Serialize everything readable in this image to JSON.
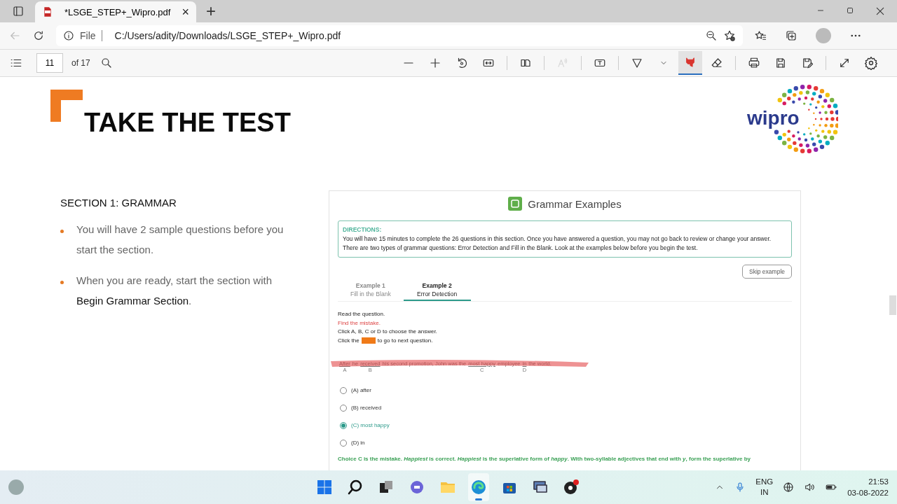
{
  "browser": {
    "tabs": [
      {
        "title": "*LSGE_STEP+_Wipro.pdf",
        "close": "×",
        "selected": true
      }
    ],
    "new_tab": "+",
    "address": {
      "info": "File",
      "url": "C:/Users/adity/Downloads/LSGE_STEP+_Wipro.pdf"
    }
  },
  "pdf_toolbar": {
    "page": "11",
    "of": "of 17",
    "tools": [
      {
        "kind": "zoom-out",
        "selected": false
      },
      {
        "kind": "zoom-in",
        "selected": false
      },
      {
        "kind": "rotate",
        "selected": false
      },
      {
        "kind": "fit",
        "selected": false
      },
      {
        "kind": "sep"
      },
      {
        "kind": "two-page",
        "selected": false
      },
      {
        "kind": "sep"
      },
      {
        "kind": "read-aloud",
        "selected": false,
        "disabled": true
      },
      {
        "kind": "sep"
      },
      {
        "kind": "text",
        "selected": false
      },
      {
        "kind": "sep"
      },
      {
        "kind": "draw",
        "selected": false
      },
      {
        "kind": "caret",
        "selected": false
      },
      {
        "kind": "highlight",
        "selected": true
      },
      {
        "kind": "erase",
        "selected": false
      },
      {
        "kind": "sep"
      },
      {
        "kind": "print",
        "selected": false
      },
      {
        "kind": "save",
        "selected": false
      },
      {
        "kind": "save-as",
        "selected": false
      },
      {
        "kind": "sep"
      },
      {
        "kind": "fullscreen",
        "selected": false
      },
      {
        "kind": "settings",
        "selected": false
      }
    ]
  },
  "slide": {
    "title": "TAKE THE TEST",
    "logo": "wipro",
    "section": "SECTION 1: GRAMMAR",
    "bullets": [
      "You will have 2 sample questions before you start the section.",
      "When you are ready, start the section with **Begin Grammar Section**."
    ],
    "example": {
      "title": "Grammar Examples",
      "directions_label": "DIRECTIONS:",
      "directions": [
        "You will have 15 minutes to complete the 26 questions in this section. Once you have answered a question, you may not go back to review or change your answer.",
        "There are two types of grammar questions: Error Detection and Fill in the Blank. Look at the examples below before you begin the test."
      ],
      "skip": "Skip example",
      "tabs": [
        {
          "title": "Example 1",
          "subtitle": "Fill in the Blank",
          "selected": false
        },
        {
          "title": "Example 2",
          "subtitle": "Error Detection",
          "selected": true
        }
      ],
      "instructions": [
        {
          "kind": "plain",
          "text": "Read the question."
        },
        {
          "kind": "alert",
          "text": "Find the mistake."
        },
        {
          "kind": "plain",
          "text": "Click A, B, C or D to choose the answer."
        },
        {
          "kind": "button",
          "before": "Click the",
          "after": "to go to next question."
        }
      ],
      "sentence": [
        {
          "text": "After",
          "letter": "A"
        },
        {
          "text": "he"
        },
        {
          "text": "received",
          "letter": "B"
        },
        {
          "text": "his second promotion, John was the"
        },
        {
          "text": "most happy",
          "letter": "C"
        },
        {
          "text": "employee"
        },
        {
          "text": "in",
          "letter": "D"
        },
        {
          "text": "the world."
        }
      ],
      "options": [
        {
          "label": "(A) after",
          "selected": false
        },
        {
          "label": "(B) received",
          "selected": false
        },
        {
          "label": "(C) most happy",
          "selected": true
        },
        {
          "label": "(D) in",
          "selected": false
        }
      ],
      "explanation": "Choice C is the mistake. *Happiest* is correct. *Happiest* is the superlative form of *happy*. With two-syllable adjectives that end with *y*, form the superlative by"
    }
  },
  "taskbar": {
    "apps": [
      {
        "kind": "start",
        "selected": false
      },
      {
        "kind": "search",
        "selected": false
      },
      {
        "kind": "taskview",
        "selected": false
      },
      {
        "kind": "chat",
        "selected": false
      },
      {
        "kind": "folder",
        "selected": false
      },
      {
        "kind": "edge",
        "selected": true
      },
      {
        "kind": "store",
        "selected": false
      },
      {
        "kind": "monitor",
        "selected": false
      },
      {
        "kind": "recorder",
        "selected": false
      }
    ],
    "lang": "ENG",
    "region": "IN",
    "time": "21:53",
    "date": "03-08-2022"
  }
}
